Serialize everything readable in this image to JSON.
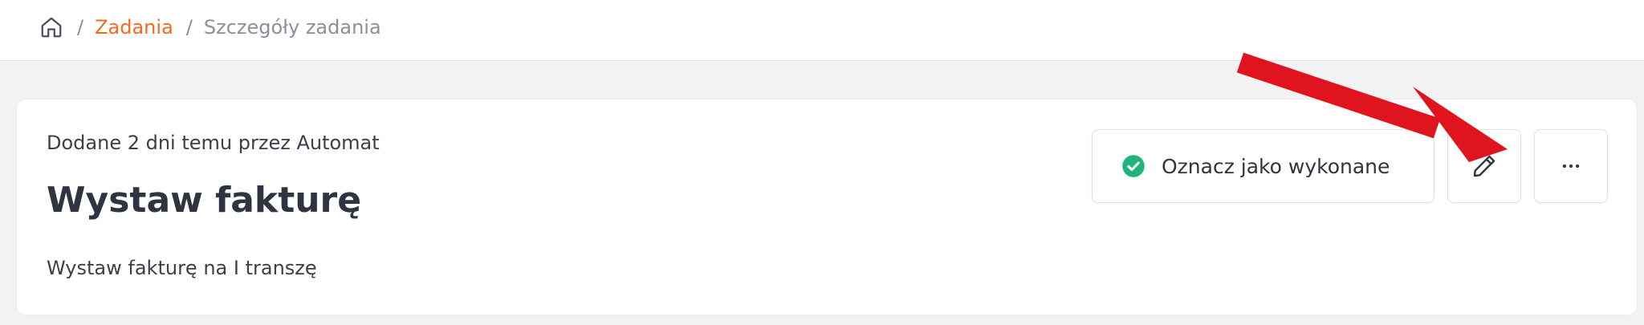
{
  "breadcrumb": {
    "home_icon": "home-icon",
    "separator": "/",
    "tasks_label": "Zadania",
    "current_label": "Szczegóły zadania"
  },
  "task": {
    "meta": "Dodane 2 dni temu przez Automat",
    "title": "Wystaw fakturę",
    "description": "Wystaw fakturę na I transzę"
  },
  "actions": {
    "mark_done_label": "Oznacz jako wykonane",
    "mark_done_icon": "check-circle-icon",
    "edit_icon": "pencil-icon",
    "more_icon": "more-horizontal-icon"
  },
  "colors": {
    "accent": "#f26a1b",
    "success": "#1fb57a",
    "annotation_arrow": "#e0141e",
    "page_bg": "#f2f2f2"
  }
}
